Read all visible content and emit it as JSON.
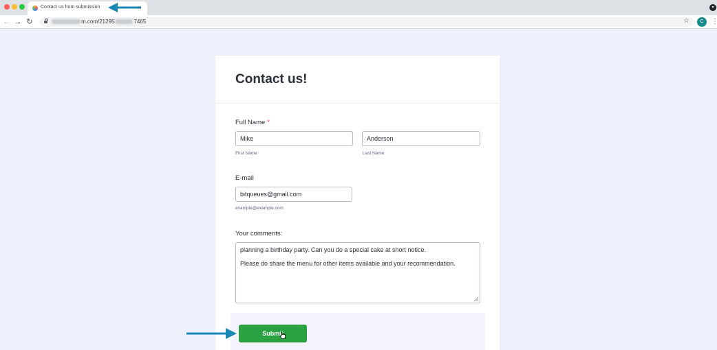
{
  "browser": {
    "tab_title": "Contact us from submission",
    "tab_close": "×",
    "url_visible": "m.com/21295",
    "url_tail": "7465",
    "profile_initial": "C"
  },
  "form": {
    "title": "Contact us!",
    "full_name": {
      "label": "Full Name",
      "required_mark": "*",
      "first_value": "Mike",
      "first_sublabel": "First Name",
      "last_value": "Anderson",
      "last_sublabel": "Last Name"
    },
    "email": {
      "label": "E-mail",
      "value": "bitqueues@gmail.com",
      "sublabel": "example@example.com"
    },
    "comments": {
      "label": "Your comments:",
      "line1": "planning a birthday party. Can you do a special cake at short notice.",
      "line2": "Please do share the menu for other items available and your recommendation."
    },
    "submit_label": "Submit"
  },
  "colors": {
    "page_background": "#eef0fb",
    "submit_button": "#2ba242",
    "annotation_arrow": "#1b87b5",
    "required_mark": "#f23a3c"
  },
  "icons": [
    "back-arrow-icon",
    "forward-arrow-icon",
    "reload-icon",
    "lock-icon",
    "star-icon",
    "kebab-menu-icon",
    "hand-cursor-icon"
  ]
}
